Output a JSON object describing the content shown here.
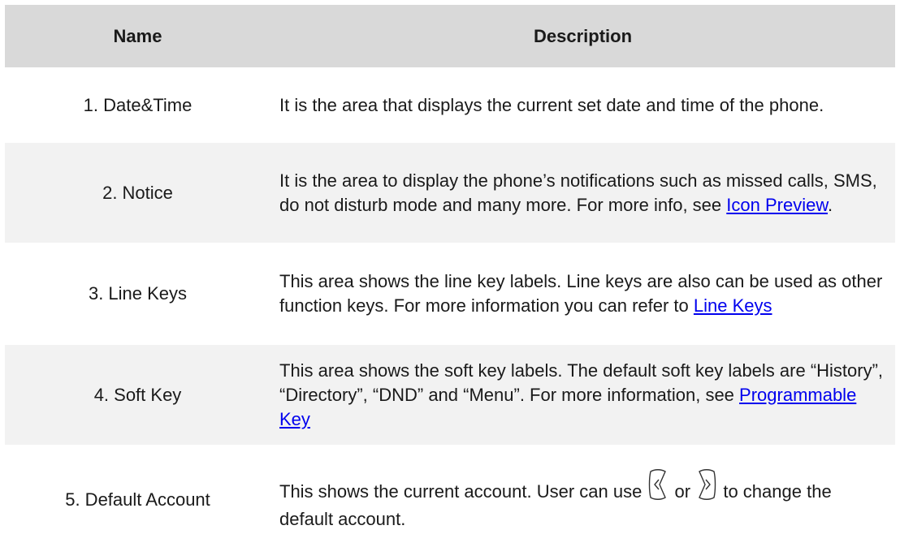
{
  "table": {
    "headers": {
      "name": "Name",
      "description": "Description"
    },
    "rows": [
      {
        "name": "1. Date&Time",
        "desc": "It is the area that displays the current set date and time of the phone."
      },
      {
        "name": "2. Notice",
        "desc_before": "It is the area to display the phone’s notifications such as missed calls, SMS, do not disturb mode and many more. For more info, see ",
        "link": "Icon Preview",
        "desc_after": "."
      },
      {
        "name": "3. Line Keys",
        "desc_before": "This area shows the line key labels. Line keys are also can be used as other function keys. For more information you can refer to ",
        "link": "Line Keys"
      },
      {
        "name": "4. Soft Key",
        "desc_before": "This area shows the soft key labels. The default soft key labels are “History”, “Directory”, “DND” and “Menu”. For more information, see ",
        "link": "Programmable Key"
      },
      {
        "name": "5. Default Account",
        "desc_before": "This shows the current account. User can use ",
        "icon_left": "left-navigation-key-icon",
        "desc_mid": " or ",
        "icon_right": "right-navigation-key-icon",
        "desc_after": " to change the default account."
      }
    ]
  }
}
